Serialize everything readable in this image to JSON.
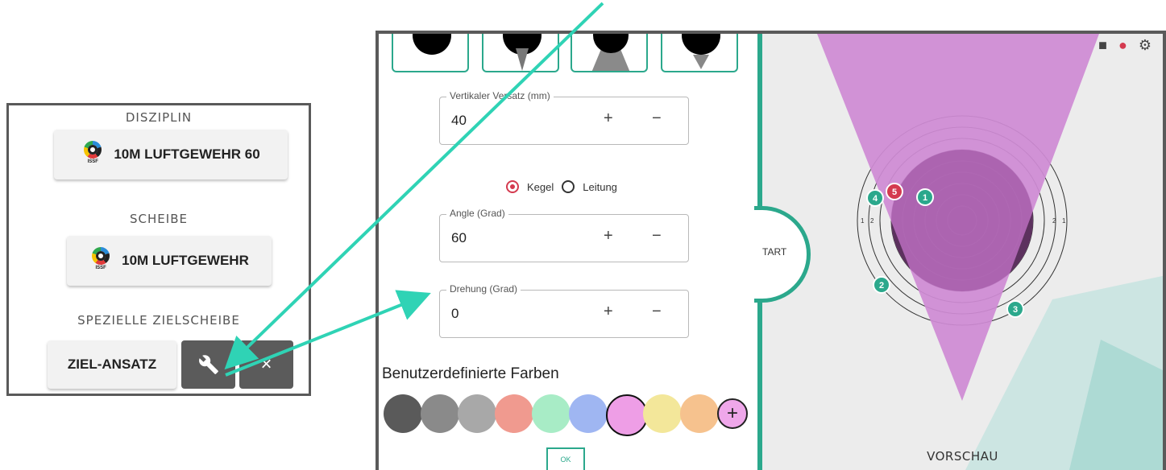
{
  "left": {
    "disziplin_title": "DISZIPLIN",
    "disziplin_button": "10M LUFTGEWEHR 60",
    "scheibe_title": "SCHEIBE",
    "scheibe_button": "10M LUFTGEWEHR",
    "spezielle_title": "SPEZIELLE ZIELSCHEIBE",
    "ziel_button": "ZIEL-ANSATZ",
    "issf_logo_text": "ISSF",
    "wrench_icon": "wrench-icon",
    "close_icon": "close-icon",
    "close_glyph": "×"
  },
  "form": {
    "vertikal": {
      "label": "Vertikaler Versatz (mm)",
      "value": "40"
    },
    "radio_kegel": "Kegel",
    "radio_leitung": "Leitung",
    "angle": {
      "label": "Angle (Grad)",
      "value": "60"
    },
    "drehung": {
      "label": "Drehung (Grad)",
      "value": "0"
    },
    "plus": "+",
    "minus": "−",
    "colors_title": "Benutzerdefinierte Farben",
    "add_color": "+",
    "ok": "OK"
  },
  "swatches": [
    "#5a5a5a",
    "#8a8a8a",
    "#a8a8a8",
    "#f09a8f",
    "#a8ecc6",
    "#9fb6f2",
    "#ee9ee6",
    "#f3e79a",
    "#f6c28e",
    "#efa7ea"
  ],
  "preview": {
    "start_label": "TART",
    "vorschau": "VORSCHAU",
    "icons": [
      "lock-icon",
      "thermometer-icon",
      "gear-icon"
    ],
    "ring_numbers": [
      "1",
      "2",
      "3",
      "2",
      "1"
    ],
    "shots": [
      "1",
      "2",
      "3",
      "4",
      "5"
    ]
  },
  "colors": {
    "accent": "#2ba88c",
    "cone": "#cf8bd4",
    "shot_red": "#d43a4f"
  }
}
